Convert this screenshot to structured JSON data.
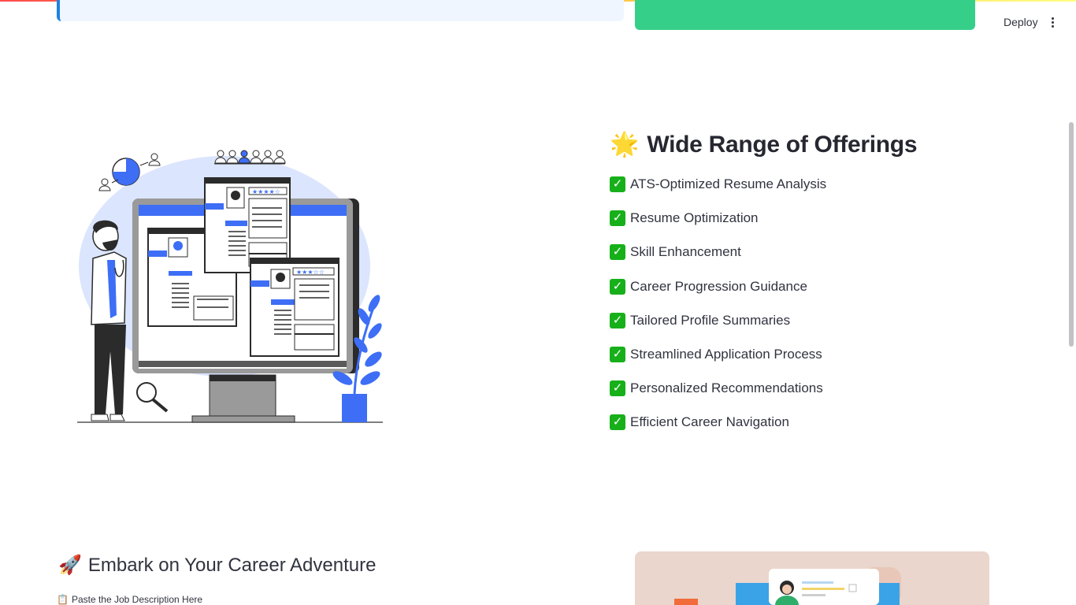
{
  "header": {
    "deploy_label": "Deploy",
    "menu_icon": "kebab-menu-icon"
  },
  "offerings": {
    "emoji": "🌟",
    "title": "Wide Range of Offerings",
    "check_icon": "check-mark-icon",
    "items": [
      "ATS-Optimized Resume Analysis",
      "Resume Optimization",
      "Skill Enhancement",
      "Career Progression Guidance",
      "Tailored Profile Summaries",
      "Streamlined Application Process",
      "Personalized Recommendations",
      "Efficient Career Navigation"
    ]
  },
  "adventure": {
    "emoji": "🚀",
    "title": "Embark on Your Career Adventure",
    "paste_icon": "📋",
    "paste_label": "Paste the Job Description Here"
  },
  "colors": {
    "accent_blue": "#3d6ef5",
    "success_green": "#36cf8a",
    "check_green": "#17b01a",
    "info_bg": "#eff6ff"
  }
}
